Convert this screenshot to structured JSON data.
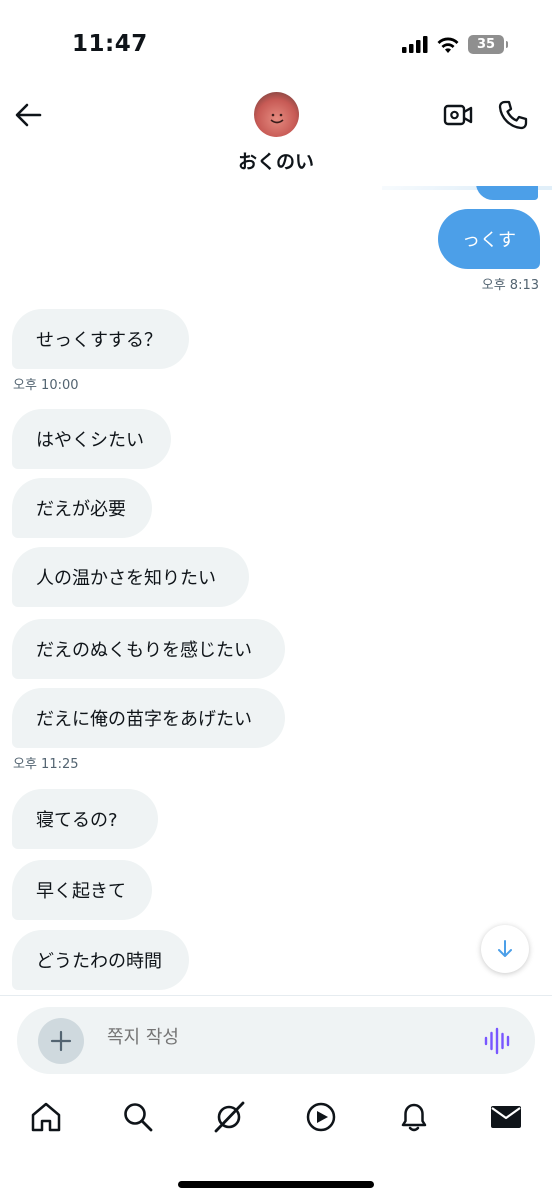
{
  "status_bar": {
    "time": "11:47",
    "battery": "35",
    "icons": [
      "cellular-signal-icon",
      "wifi-icon",
      "battery-icon"
    ]
  },
  "header": {
    "contact_name": "おくのい",
    "icons": [
      "back-arrow-icon",
      "avatar",
      "video-call-icon",
      "phone-icon"
    ]
  },
  "messages": {
    "outgoing": [
      {
        "text": "っくす",
        "time": "오후 8:13"
      }
    ],
    "incoming": [
      {
        "text": "せっくすする？"
      },
      {
        "text": "はやくシたい"
      },
      {
        "text": "だえが必要"
      },
      {
        "text": "人の温かさを知りたい"
      },
      {
        "text": "だえのぬくもりを感じたい"
      },
      {
        "text": "だえに俺の苗字をあげたい"
      },
      {
        "text": "寝てるの?"
      },
      {
        "text": "早く起きて"
      },
      {
        "text": "どうたわの時間"
      }
    ],
    "timestamps": [
      "오후 10:00",
      "오후 11:25"
    ]
  },
  "composer": {
    "placeholder": "쪽지 작성"
  },
  "tabbar": {
    "items": [
      "home-icon",
      "search-icon",
      "grok-icon",
      "video-play-icon",
      "notifications-bell-icon",
      "messages-envelope-icon"
    ]
  },
  "colors": {
    "accent": "#4c9fe8",
    "incoming_bubble": "#eff3f4",
    "voice_icon": "#7856ff",
    "muted_text": "#536471"
  }
}
